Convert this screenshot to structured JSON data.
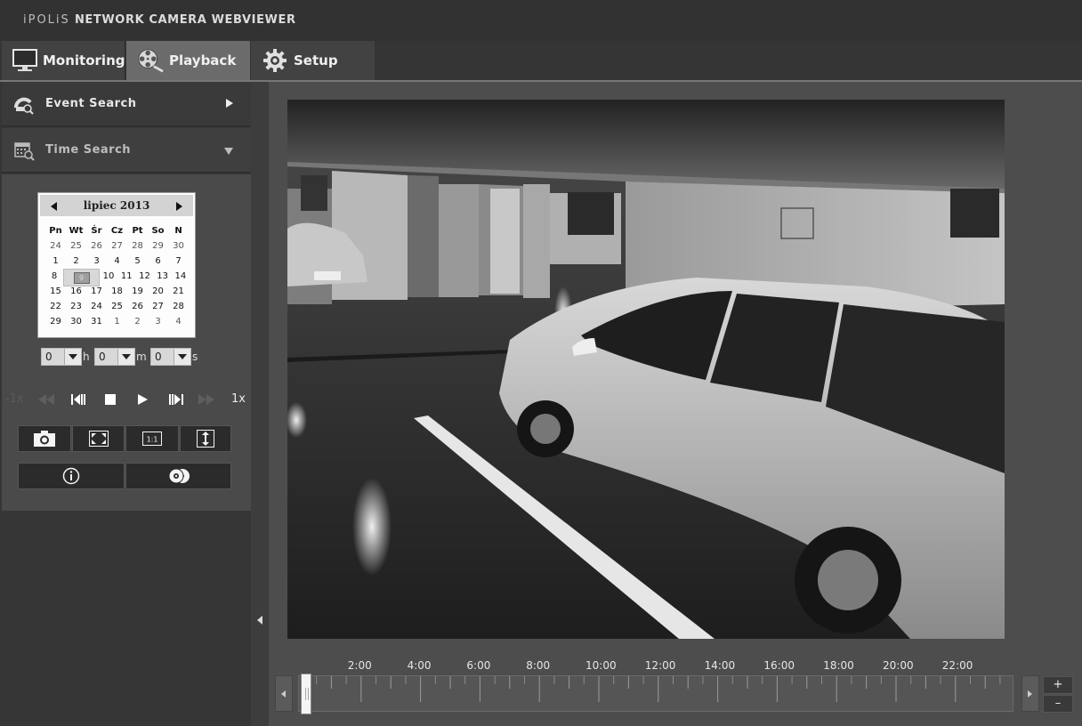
{
  "header": {
    "brand_prefix": "iPOLiS",
    "brand_rest": "NETWORK CAMERA WEBVIEWER"
  },
  "tabs": [
    {
      "label": "Monitoring",
      "icon": "monitor-icon"
    },
    {
      "label": "Playback",
      "icon": "film-reel-icon",
      "active": true
    },
    {
      "label": "Setup",
      "icon": "gear-icon"
    }
  ],
  "sidebar": {
    "event_search": {
      "label": "Event Search",
      "icon": "event-search-icon"
    },
    "time_search": {
      "label": "Time Search",
      "icon": "calendar-search-icon"
    }
  },
  "calendar": {
    "title": "lipiec 2013",
    "weekdays": [
      "Pn",
      "Wt",
      "Śr",
      "Cz",
      "Pt",
      "So",
      "N"
    ],
    "weeks": [
      [
        "24",
        "25",
        "26",
        "27",
        "28",
        "29",
        "30"
      ],
      [
        "1",
        "2",
        "3",
        "4",
        "5",
        "6",
        "7"
      ],
      [
        "8",
        "9",
        "10",
        "11",
        "12",
        "13",
        "14"
      ],
      [
        "15",
        "16",
        "17",
        "18",
        "19",
        "20",
        "21"
      ],
      [
        "22",
        "23",
        "24",
        "25",
        "26",
        "27",
        "28"
      ],
      [
        "29",
        "30",
        "31",
        "1",
        "2",
        "3",
        "4"
      ]
    ],
    "selected_day": "9"
  },
  "time": {
    "hour": "0",
    "hour_unit": "h",
    "minute": "0",
    "minute_unit": "m",
    "second": "0",
    "second_unit": "s"
  },
  "playback": {
    "speed_left": "-1x",
    "speed_right": "1x",
    "buttons": [
      "rewind-icon",
      "step-back-icon",
      "stop-icon",
      "play-icon",
      "step-forward-icon",
      "fast-forward-icon"
    ]
  },
  "tools": [
    "camera-icon",
    "fullscreen-icon",
    "one-to-one-icon",
    "fit-icon",
    "info-icon",
    "backup-icon"
  ],
  "timeline": {
    "hours": [
      "2:00",
      "4:00",
      "6:00",
      "8:00",
      "10:00",
      "12:00",
      "14:00",
      "16:00",
      "18:00",
      "20:00",
      "22:00"
    ],
    "zoom_in": "+",
    "zoom_out": "–"
  },
  "colors": {
    "active_tab": "#6b6b6b",
    "panel": "#4a4a4a",
    "background": "#353535"
  }
}
